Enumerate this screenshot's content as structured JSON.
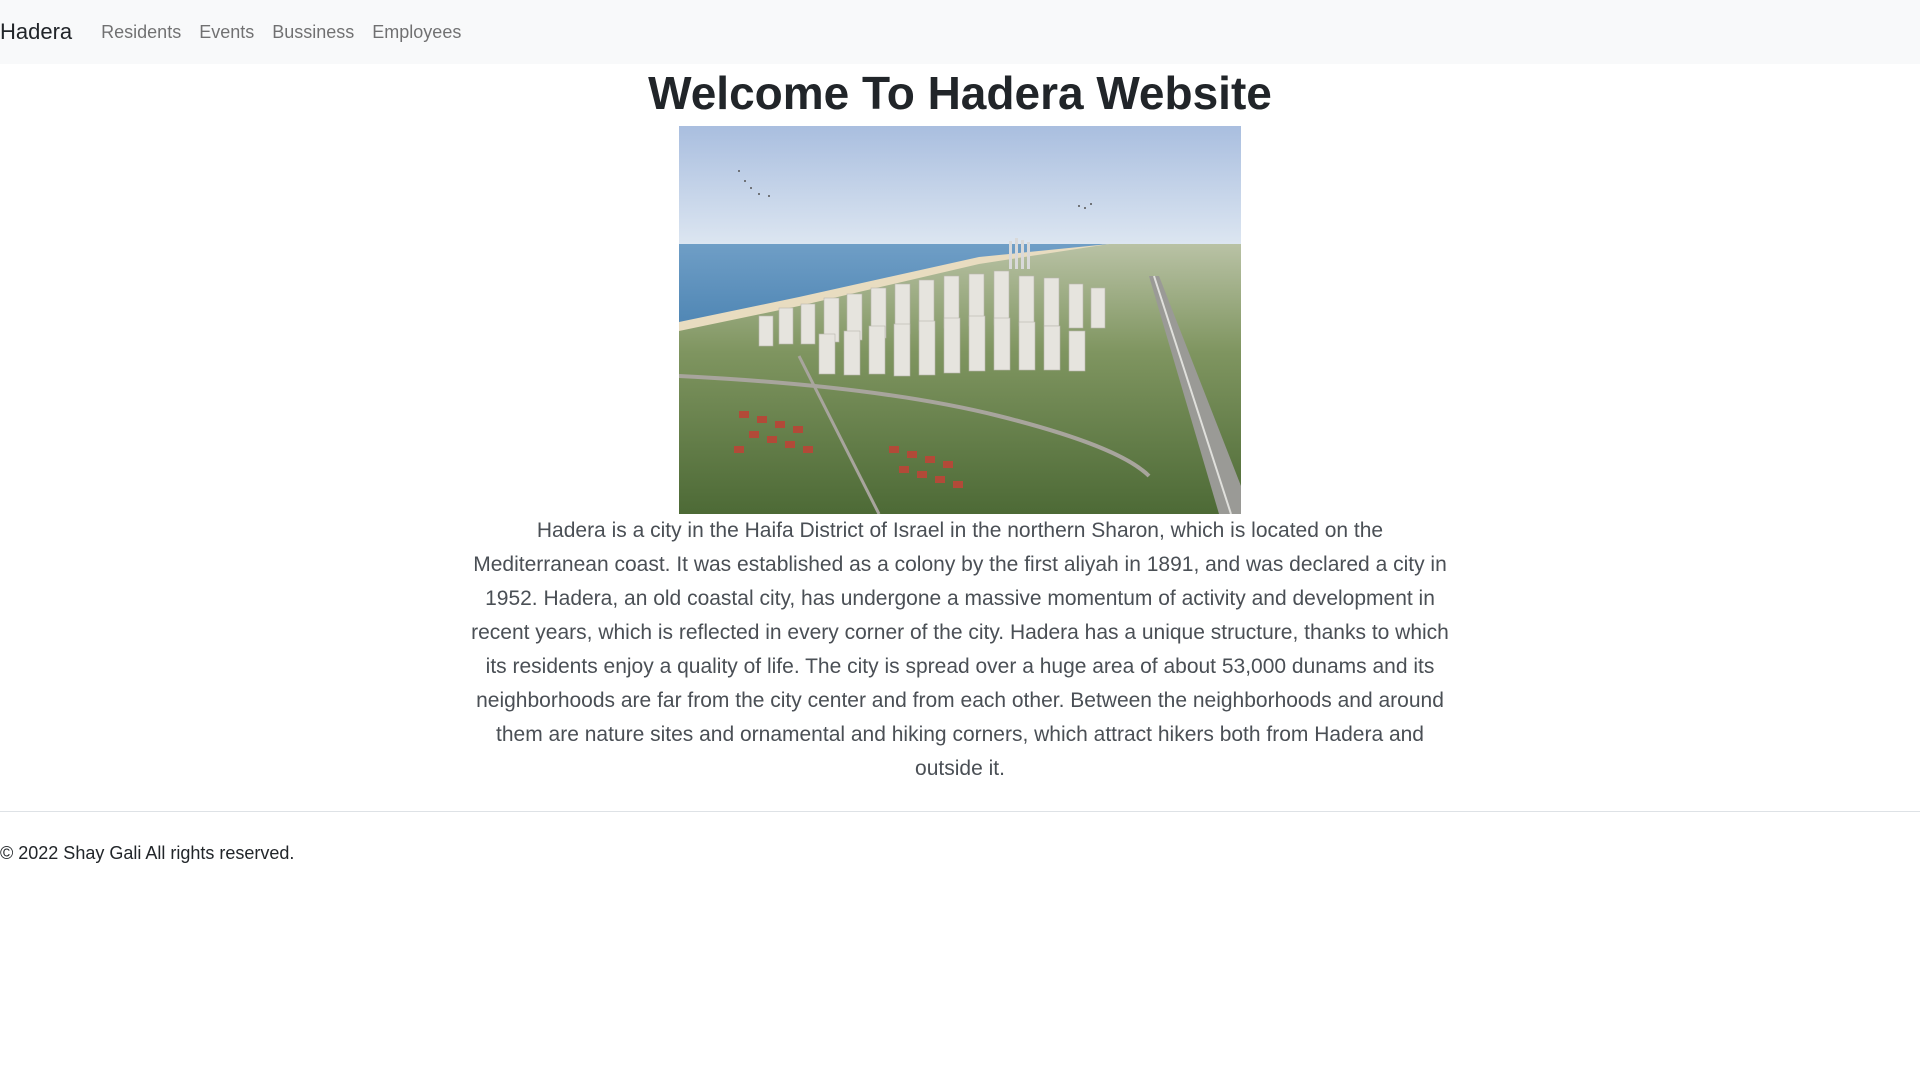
{
  "navbar": {
    "brand": "Hadera",
    "links": [
      "Residents",
      "Events",
      "Bussiness",
      "Employees"
    ]
  },
  "main": {
    "title": "Welcome To Hadera Website",
    "description": "Hadera is a city in the Haifa District of Israel in the northern Sharon, which is located on the Mediterranean coast. It was established as a colony by the first aliyah in 1891, and was declared a city in 1952. Hadera, an old coastal city, has undergone a massive momentum of activity and development in recent years, which is reflected in every corner of the city. Hadera has a unique structure, thanks to which its residents enjoy a quality of life. The city is spread over a huge area of about 53,000 dunams and its neighborhoods are far from the city center and from each other. Between the neighborhoods and around them are nature sites and ornamental and hiking corners, which attract hikers both from Hadera and outside it."
  },
  "footer": {
    "copyright": "© 2022 Shay Gali All rights reserved."
  },
  "colors": {
    "navbar_bg": "#f8f9fa",
    "text": "#212529",
    "muted_link": "#6c757d"
  }
}
